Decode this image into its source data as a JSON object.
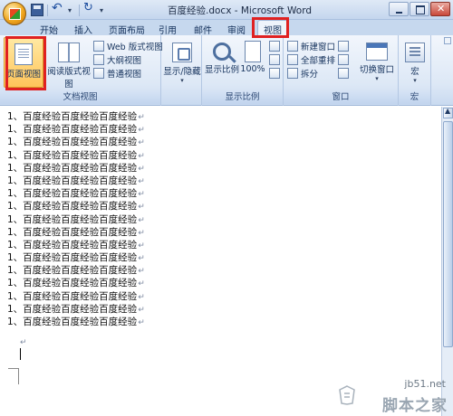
{
  "window": {
    "title": "百度经验.docx - Microsoft Word"
  },
  "tabs": [
    {
      "id": "tab-home",
      "label": "开始"
    },
    {
      "id": "tab-insert",
      "label": "插入"
    },
    {
      "id": "tab-page-layout",
      "label": "页面布局"
    },
    {
      "id": "tab-references",
      "label": "引用"
    },
    {
      "id": "tab-mailings",
      "label": "邮件"
    },
    {
      "id": "tab-review",
      "label": "审阅"
    },
    {
      "id": "tab-view",
      "label": "视图",
      "selected": true
    }
  ],
  "ribbon": {
    "document_views": {
      "group_label": "文档视图",
      "page_view": "页面视图",
      "reading_view": "阅读版式视图",
      "web_view": "Web 版式视图",
      "outline_view": "大纲视图",
      "draft_view": "普通视图"
    },
    "show_hide": {
      "label": "显示/隐藏"
    },
    "zoom": {
      "group_label": "显示比例",
      "zoom_label": "显示比例",
      "hundred_label": "100%"
    },
    "window": {
      "group_label": "窗口",
      "new_window": "新建窗口",
      "arrange_all": "全部重排",
      "split": "拆分",
      "switch_windows": "切换窗口"
    },
    "macros": {
      "group_label": "宏",
      "label": "宏"
    }
  },
  "document": {
    "line_text": "1、百度经验百度经验百度经验",
    "line_count": 17,
    "paragraph_mark": "↵"
  },
  "watermark": {
    "url": "jb51.net",
    "site": "脚本之家"
  },
  "colors": {
    "highlight": "#e02121",
    "ribbon_bg": "#dde8f6",
    "selected_button": "#ffc55a"
  }
}
